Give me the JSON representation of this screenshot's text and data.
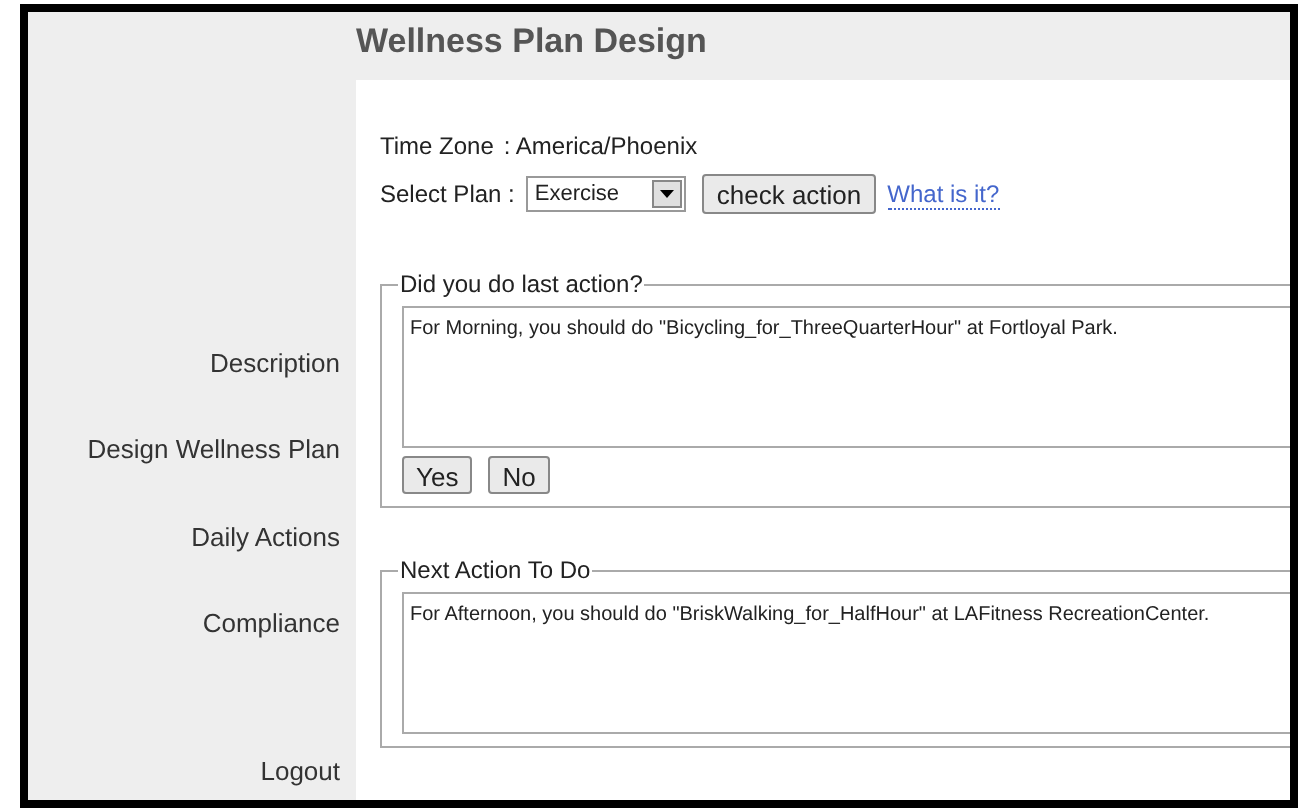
{
  "header": {
    "title": "Wellness Plan Design"
  },
  "sidebar": {
    "items": [
      {
        "label": "Description"
      },
      {
        "label": "Design Wellness Plan"
      },
      {
        "label": "Daily Actions"
      },
      {
        "label": "Compliance"
      },
      {
        "label": "Logout"
      }
    ]
  },
  "form": {
    "time_zone": {
      "label": "Time Zone",
      "value": ": America/Phoenix"
    },
    "select_plan": {
      "label": "Select Plan :",
      "value": "Exercise",
      "button": "check action",
      "link": "What is it?"
    },
    "last_action": {
      "legend": "Did you do last action?",
      "text": "For Morning, you should do \"Bicycling_for_ThreeQuarterHour\" at Fortloyal Park.",
      "buttons": [
        "Yes",
        "No"
      ]
    },
    "next_action": {
      "legend": "Next Action To Do",
      "text": "For Afternoon, you should do \"BriskWalking_for_HalfHour\" at LAFitness RecreationCenter."
    }
  }
}
